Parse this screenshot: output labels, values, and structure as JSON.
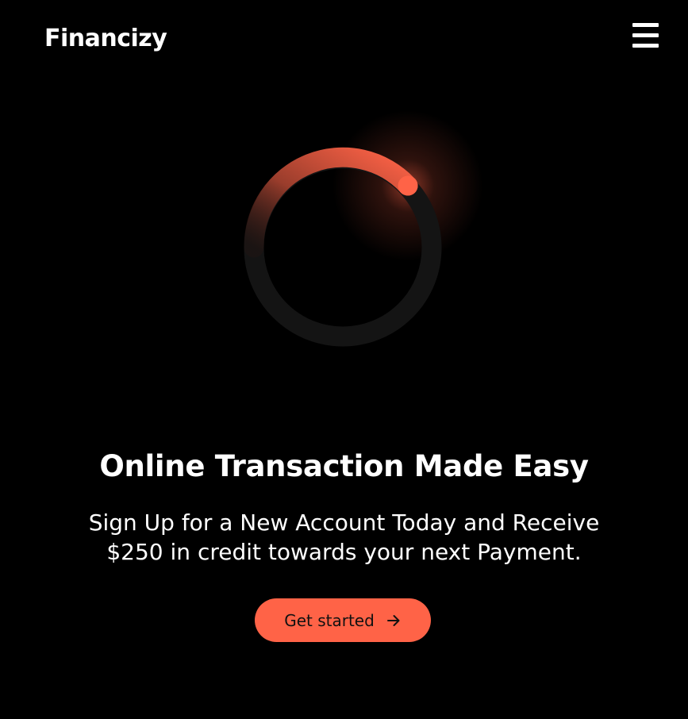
{
  "header": {
    "logo": "Financizy",
    "menu_icon": "hamburger-menu-icon"
  },
  "hero": {
    "graphic_icon": "loading-ring-icon",
    "headline": "Online Transaction Made Easy",
    "subtext_line1": "Sign Up for a New Account Today and Receive",
    "subtext_line2": "$250 in credit towards your next Payment.",
    "cta_label": "Get started",
    "cta_icon": "arrow-right-icon"
  },
  "colors": {
    "background": "#000000",
    "accent": "#ff6347",
    "ring_track": "#141414",
    "text": "#ffffff"
  }
}
